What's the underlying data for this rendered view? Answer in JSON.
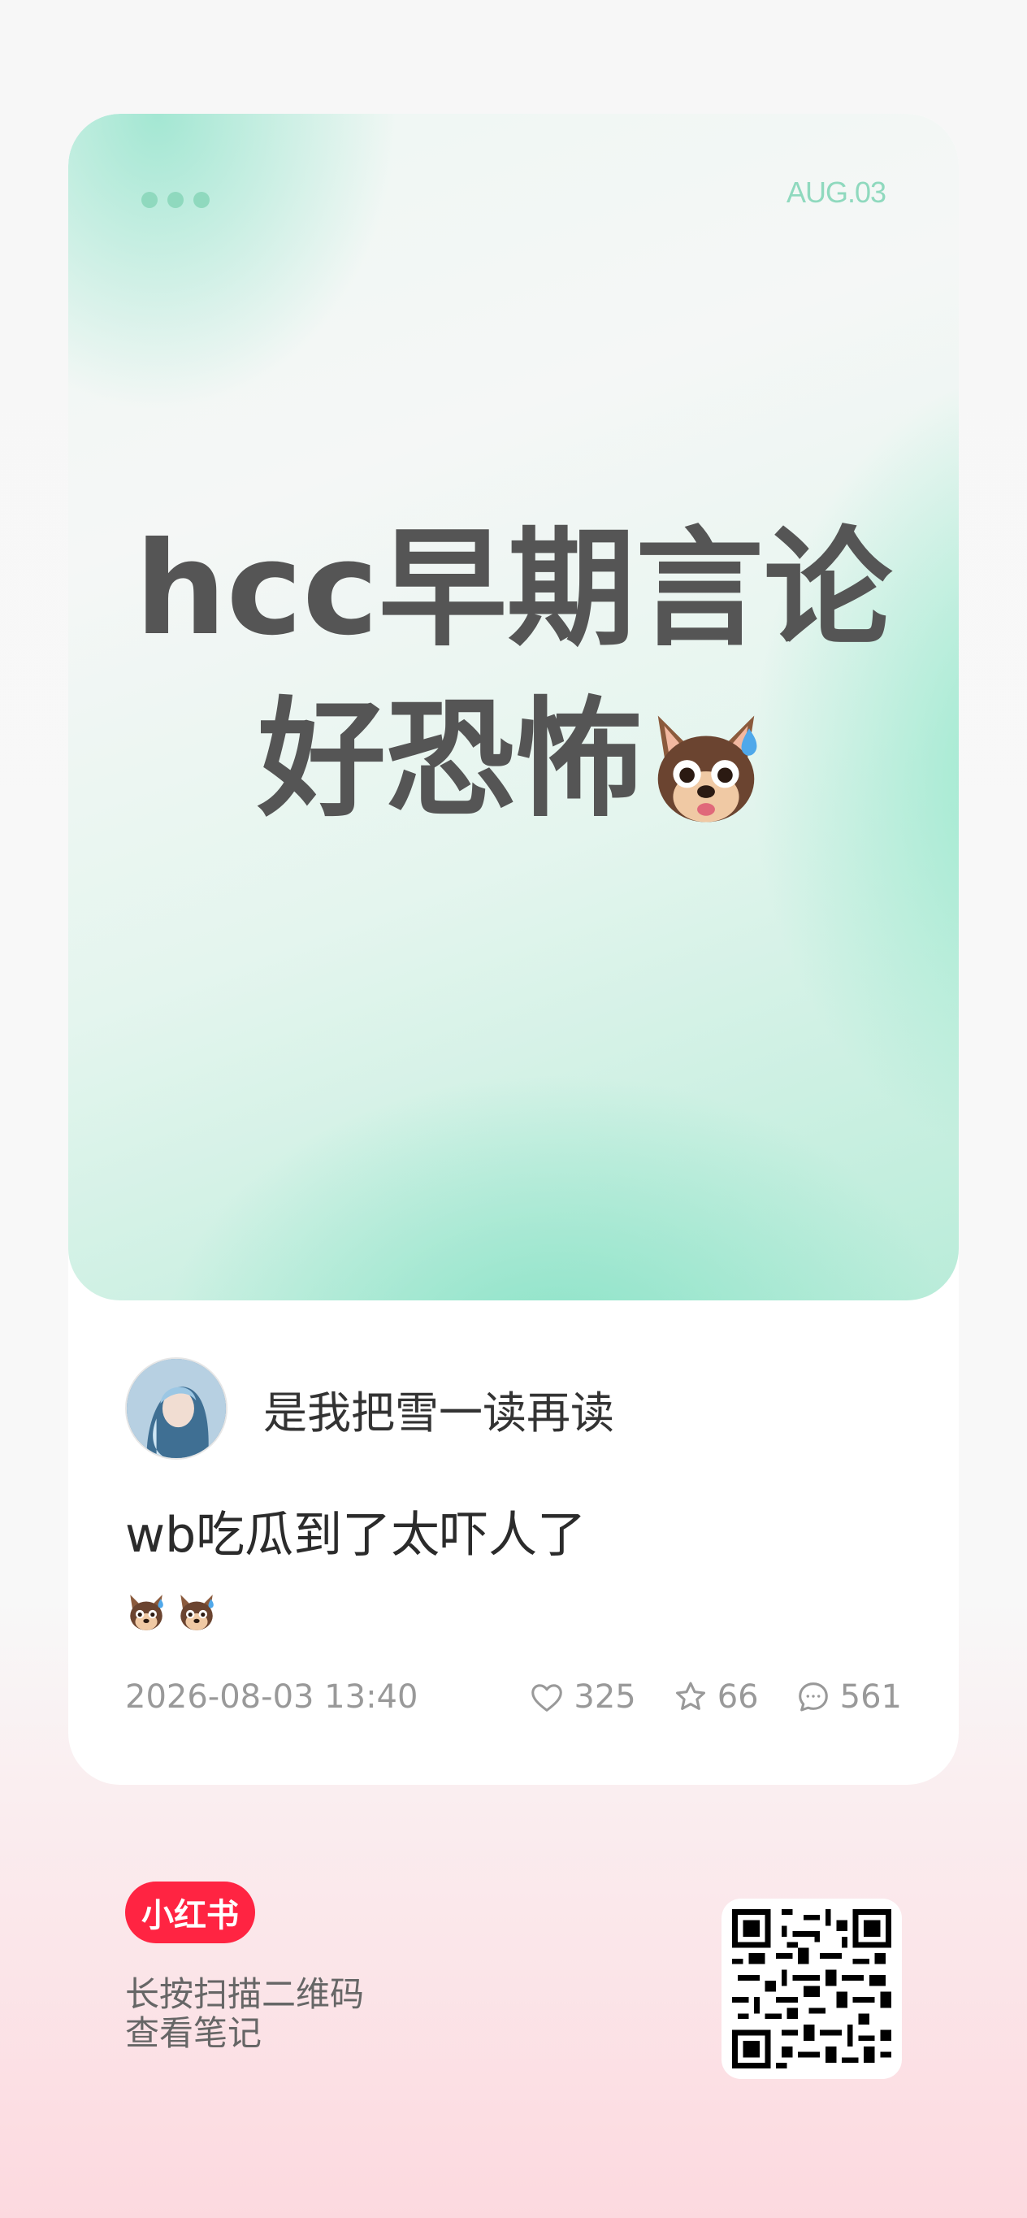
{
  "card": {
    "date_tag": "AUG.03",
    "title_line1": "hcc早期言论",
    "title_line2": "好恐怖",
    "title_emoji": "dog-face-sweat-emoji"
  },
  "author": {
    "name": "是我把雪一读再读",
    "avatar": "avatar-image"
  },
  "note": {
    "text": "wb吃瓜到了太吓人了",
    "emojis": [
      "dog-face-sweat-emoji",
      "dog-face-sweat-emoji"
    ],
    "timestamp": "2026-08-03 13:40",
    "likes": "325",
    "favorites": "66",
    "comments": "561"
  },
  "footer": {
    "brand": "小红书",
    "hint_line1": "长按扫描二维码",
    "hint_line2": "查看笔记"
  },
  "colors": {
    "accent_mint": "#8fd9be",
    "brand_red": "#ff2442",
    "title_gray": "#555555"
  }
}
